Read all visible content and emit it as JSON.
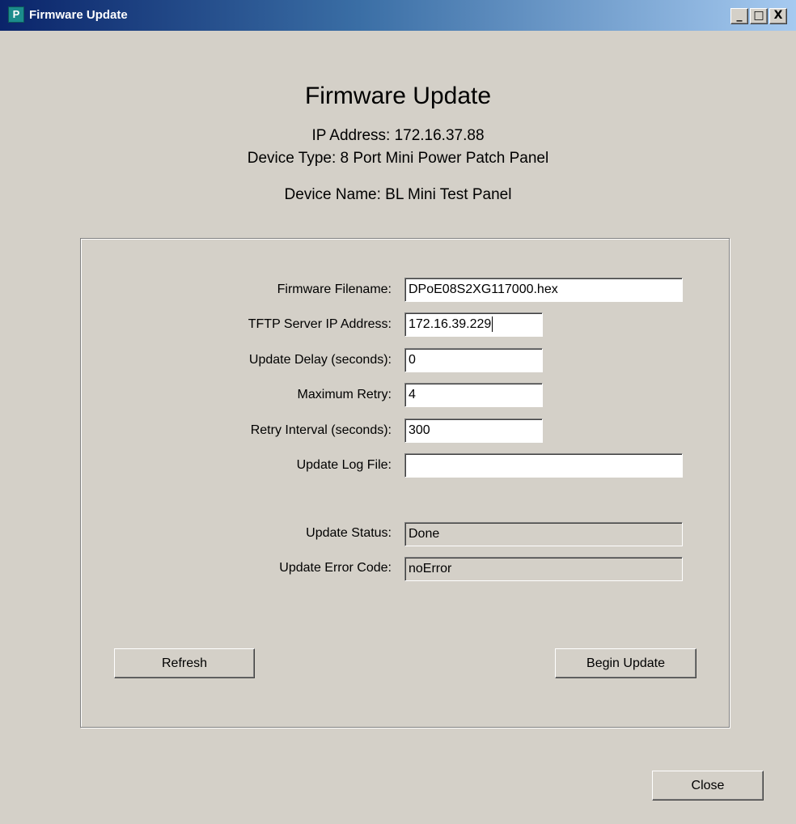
{
  "window": {
    "title": "Firmware Update",
    "controls": {
      "minimize": "_",
      "maximize": "□",
      "close": "X"
    }
  },
  "header": {
    "title": "Firmware Update",
    "ip_address": "IP Address: 172.16.37.88",
    "device_type": "Device Type: 8 Port Mini Power Patch Panel",
    "device_name": "Device Name: BL Mini Test Panel"
  },
  "form": {
    "firmware_filename": {
      "label": "Firmware Filename:",
      "value": "DPoE08S2XG117000.hex"
    },
    "tftp_server": {
      "label": "TFTP Server IP Address:",
      "value": "172.16.39.229"
    },
    "update_delay": {
      "label": "Update Delay (seconds):",
      "value": "0"
    },
    "max_retry": {
      "label": "Maximum Retry:",
      "value": "4"
    },
    "retry_interval": {
      "label": "Retry Interval (seconds):",
      "value": "300"
    },
    "log_file": {
      "label": "Update Log File:",
      "value": ""
    },
    "status": {
      "label": "Update Status:",
      "value": "Done"
    },
    "error_code": {
      "label": "Update Error Code:",
      "value": "noError"
    }
  },
  "buttons": {
    "refresh": "Refresh",
    "begin_update": "Begin Update",
    "close": "Close"
  },
  "icons": {
    "app": "app-icon"
  }
}
